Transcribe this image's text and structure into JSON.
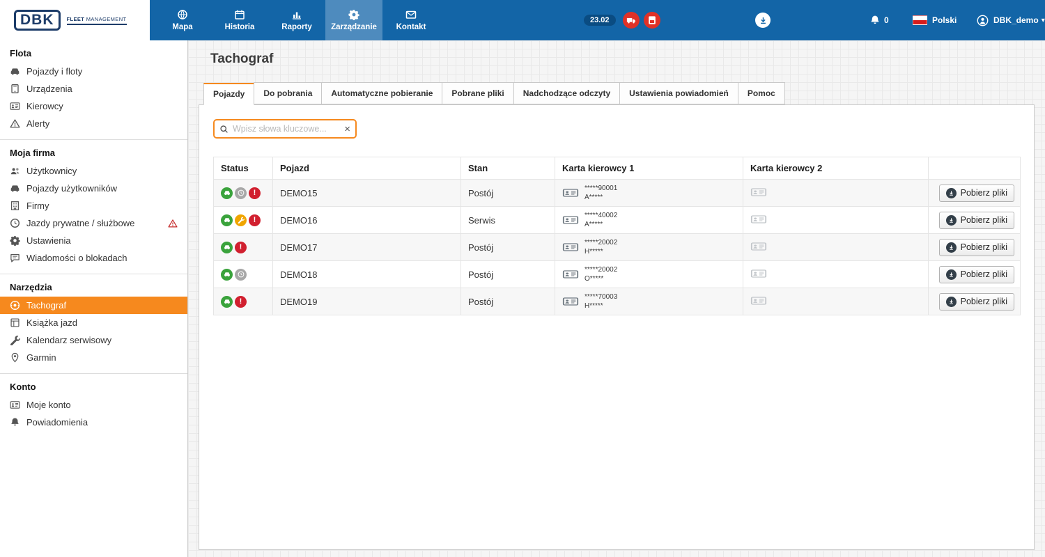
{
  "colors": {
    "topbar_blue": "#1365a7",
    "active_nav_blue": "#4e8bbe",
    "accent_orange": "#f6891e",
    "badge_red": "#e03127",
    "status_green": "#3aa33c",
    "status_yellow": "#f0a500",
    "status_red": "#d1202f",
    "status_gray": "#a8a8a8"
  },
  "topbar": {
    "logo": {
      "abbr": "DBK",
      "fleet": "FLEET",
      "management": "MANAGEMENT"
    },
    "nav": [
      {
        "label": "Mapa",
        "icon": "globe",
        "active": false
      },
      {
        "label": "Historia",
        "icon": "calendar",
        "active": false
      },
      {
        "label": "Raporty",
        "icon": "chart",
        "active": false
      },
      {
        "label": "Zarządzanie",
        "icon": "gear",
        "active": true
      },
      {
        "label": "Kontakt",
        "icon": "envelope",
        "active": false
      }
    ],
    "date_badge": "23.02",
    "badges": [
      {
        "icon": "truck"
      },
      {
        "icon": "driver-card"
      }
    ],
    "notification_count": "0",
    "language": "Polski",
    "user_name": "DBK_demo"
  },
  "sidebar": {
    "sections": [
      {
        "title": "Flota",
        "items": [
          {
            "label": "Pojazdy i floty",
            "icon": "car"
          },
          {
            "label": "Urządzenia",
            "icon": "device"
          },
          {
            "label": "Kierowcy",
            "icon": "idcard"
          },
          {
            "label": "Alerty",
            "icon": "warning"
          }
        ]
      },
      {
        "title": "Moja firma",
        "items": [
          {
            "label": "Użytkownicy",
            "icon": "users"
          },
          {
            "label": "Pojazdy użytkowników",
            "icon": "car"
          },
          {
            "label": "Firmy",
            "icon": "building"
          },
          {
            "label": "Jazdy prywatne / służbowe",
            "icon": "clock",
            "warning": true
          },
          {
            "label": "Ustawienia",
            "icon": "gear"
          },
          {
            "label": "Wiadomości o blokadach",
            "icon": "message"
          }
        ]
      },
      {
        "title": "Narzędzia",
        "items": [
          {
            "label": "Tachograf",
            "icon": "tacho",
            "active": true
          },
          {
            "label": "Książka jazd",
            "icon": "book"
          },
          {
            "label": "Kalendarz serwisowy",
            "icon": "wrench"
          },
          {
            "label": "Garmin",
            "icon": "pin"
          }
        ]
      },
      {
        "title": "Konto",
        "items": [
          {
            "label": "Moje konto",
            "icon": "idcard"
          },
          {
            "label": "Powiadomienia",
            "icon": "bell"
          }
        ]
      }
    ]
  },
  "main": {
    "title": "Tachograf",
    "tabs": [
      {
        "label": "Pojazdy",
        "active": true
      },
      {
        "label": "Do pobrania",
        "active": false
      },
      {
        "label": "Automatyczne pobieranie",
        "active": false
      },
      {
        "label": "Pobrane pliki",
        "active": false
      },
      {
        "label": "Nadchodzące odczyty",
        "active": false
      },
      {
        "label": "Ustawienia powiadomień",
        "active": false
      },
      {
        "label": "Pomoc",
        "active": false
      }
    ],
    "search_placeholder": "Wpisz słowa kluczowe...",
    "table": {
      "headers": [
        "Status",
        "Pojazd",
        "Stan",
        "Karta kierowcy 1",
        "Karta kierowcy 2",
        ""
      ],
      "rows": [
        {
          "vehicle": "DEMO15",
          "state": "Postój",
          "statuses": [
            "green-car",
            "gray-clock",
            "red-alert"
          ],
          "card1_line1": "*****90001",
          "card1_line2": "A*****",
          "card2": "",
          "action": "Pobierz pliki"
        },
        {
          "vehicle": "DEMO16",
          "state": "Serwis",
          "statuses": [
            "green-car",
            "yellow-wrench",
            "red-alert"
          ],
          "card1_line1": "*****40002",
          "card1_line2": "A*****",
          "card2": "",
          "action": "Pobierz pliki"
        },
        {
          "vehicle": "DEMO17",
          "state": "Postój",
          "statuses": [
            "green-car",
            "red-alert"
          ],
          "card1_line1": "*****20002",
          "card1_line2": "H*****",
          "card2": "",
          "action": "Pobierz pliki"
        },
        {
          "vehicle": "DEMO18",
          "state": "Postój",
          "statuses": [
            "green-car",
            "gray-clock"
          ],
          "card1_line1": "*****20002",
          "card1_line2": "O*****",
          "card2": "",
          "action": "Pobierz pliki"
        },
        {
          "vehicle": "DEMO19",
          "state": "Postój",
          "statuses": [
            "green-car",
            "red-alert"
          ],
          "card1_line1": "*****70003",
          "card1_line2": "H*****",
          "card2": "",
          "action": "Pobierz pliki"
        }
      ]
    }
  },
  "status_icons": {
    "green-car": {
      "color": "#3aa33c",
      "symbol": "s-car"
    },
    "gray-clock": {
      "color": "#a8a8a8",
      "symbol": "s-clock"
    },
    "yellow-wrench": {
      "color": "#f0a500",
      "symbol": "s-wrench"
    },
    "red-alert": {
      "color": "#d1202f",
      "glyph": "!"
    }
  }
}
